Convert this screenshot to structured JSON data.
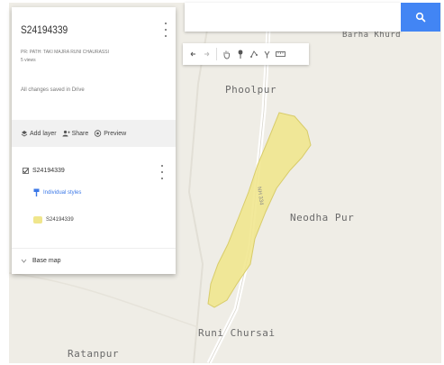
{
  "panel": {
    "map_title": "S24194339",
    "subtitle": "PR: PATH: TAKI MAJRA RUNI CHAURASSI",
    "views": "5 views",
    "save_status": "All changes saved in Drive",
    "actions": {
      "add_layer": "Add layer",
      "share": "Share",
      "preview": "Preview"
    },
    "layer": {
      "name": "S24194339",
      "style_link": "Individual styles",
      "feature_name": "S24194339"
    },
    "base_map": "Base map"
  },
  "search": {
    "value": "",
    "placeholder": ""
  },
  "map": {
    "places": [
      {
        "name": "Phoolpur"
      },
      {
        "name": "Neodha Pur"
      },
      {
        "name": "Runi Chursai"
      },
      {
        "name": "Ratanpur"
      },
      {
        "name": "Barha Khurd"
      }
    ],
    "road_label": "NH 334"
  },
  "colors": {
    "accent": "#4285f4",
    "polygon_fill": "#f0e68c",
    "polygon_stroke": "#d8cc6a",
    "map_bg": "#efede6"
  }
}
